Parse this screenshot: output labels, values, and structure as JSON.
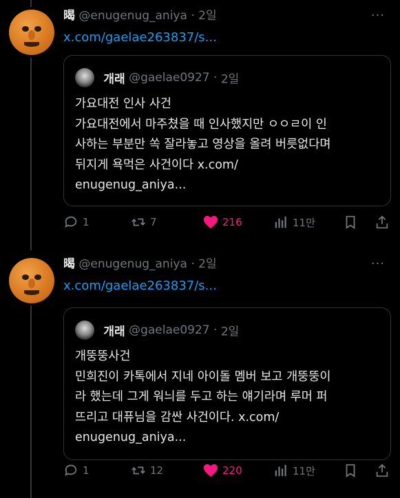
{
  "tweets": [
    {
      "name": "暍",
      "handle": "@enugenug_aniya",
      "dot": "·",
      "time": "2일",
      "more": "···",
      "link": "x.com/gaelae263837/s...",
      "quote": {
        "name": "개래",
        "handle": "@gaelae0927",
        "dot": "·",
        "time": "2일",
        "text": "가요대전 인사 사건\n가요대전에서 마주쳤을 때 인사했지만 ㅇㅇㄹ이 인\n사하는 부분만 쏙 잘라놓고 영상을 올려 버릇없다며\n뒤지게 욕먹은 사건이다 x.com/\nenugenug_aniya..."
      },
      "actions": {
        "replies": "1",
        "reposts": "7",
        "likes": "216",
        "views": "11만"
      }
    },
    {
      "name": "暍",
      "handle": "@enugenug_aniya",
      "dot": "·",
      "time": "2일",
      "more": "···",
      "link": "x.com/gaelae263837/s...",
      "quote": {
        "name": "개래",
        "handle": "@gaelae0927",
        "dot": "·",
        "time": "2일",
        "text": "개뚱뚱사건\n민희진이 카톡에서 지네 아이돌 멤버 보고 개뚱뚱이\n라 했는데 그게 워늬를 두고 하는 얘기라며 루머 퍼\n뜨리고 대퓨님을 감싼 사건이다. x.com/\nenugenug_aniya..."
      },
      "actions": {
        "replies": "1",
        "reposts": "12",
        "likes": "220",
        "views": "11만"
      }
    }
  ],
  "colors": {
    "accent": "#1d9bf0",
    "like": "#f91880",
    "muted": "#71767b"
  }
}
